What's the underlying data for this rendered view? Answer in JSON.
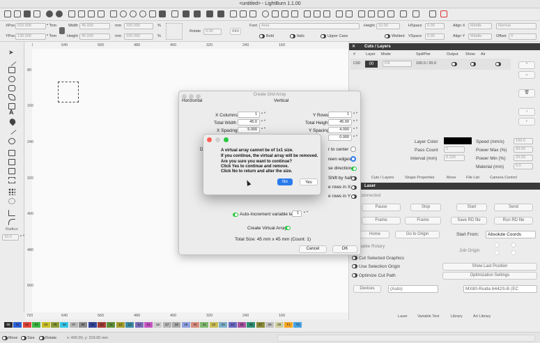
{
  "window": {
    "title": "<untitled> - LightBurn 1.1.00"
  },
  "position": {
    "xpos_label": "XPos",
    "xpos": "633.500",
    "ypos_label": "YPos",
    "ypos": "130.500",
    "unit": "mm",
    "width_label": "Width",
    "width": "45.000",
    "height_label": "Height",
    "height": "45.000",
    "scale_w": "100.000",
    "scale_h": "100.000",
    "pct": "%",
    "rotate_label": "Rotate",
    "rotate": "0.00",
    "mm_button": "mm"
  },
  "font": {
    "font_label": "Font",
    "font": "Arial",
    "height_label": "Height",
    "height": "10.00",
    "hspace_label": "HSpace",
    "hspace": "0.00",
    "align_x_label": "Align X",
    "align_x": "Middle",
    "normal": "Normal",
    "bold": "Bold",
    "italic": "Italic",
    "upper_case": "Upper Case",
    "welded": "Welded",
    "vspace_label": "VSpace",
    "vspace": "0.00",
    "align_y_label": "Align Y",
    "align_y": "Middle",
    "offset_label": "Offset",
    "offset": "0"
  },
  "left_tools": {
    "radius_label": "Radius:",
    "radius": "10.0"
  },
  "rulers": {
    "top": [
      "720",
      "640",
      "560",
      "480",
      "400",
      "320",
      "240",
      "160"
    ],
    "side": [
      "80",
      "160",
      "240",
      "320",
      "400",
      "480",
      "560"
    ],
    "bottom": [
      "720",
      "640",
      "560",
      "480",
      "400",
      "320",
      "240",
      "160"
    ]
  },
  "cuts_layers": {
    "title": "Cuts / Layers",
    "columns": [
      "#",
      "Layer",
      "Mode",
      "Spd/Pwr",
      "Output",
      "Show",
      "Air"
    ],
    "row": {
      "num": "C00",
      "layer": "00",
      "mode": "Fill",
      "spd_pwr": "100.0 / 20.0"
    },
    "layer_color_label": "Layer Color",
    "speed_label": "Speed (mm/s)",
    "speed": "100.0",
    "pass_count_label": "Pass Count",
    "pass_count": "1",
    "power_max_label": "Power Max (%)",
    "power_max": "20.00",
    "interval_label": "Interval (mm)",
    "interval": "0.100",
    "power_min_label": "Power Min (%)",
    "power_min": "20.00",
    "material_label": "Material (mm)",
    "material": "0.0"
  },
  "panel_tabs": [
    "Cuts / Layers",
    "Shape Properties",
    "Move",
    "File List",
    "Camera Control"
  ],
  "laser": {
    "title": "Laser",
    "status": "Disconnected",
    "pause": "Pause",
    "stop": "Stop",
    "start": "Start",
    "send": "Send",
    "frame1": "Frame",
    "frame2": "Frame",
    "save_rd": "Save RD file",
    "run_rd": "Run RD file",
    "home": "Home",
    "go_to_origin": "Go to Origin",
    "start_from_label": "Start From:",
    "start_from": "Absolute Coords",
    "enable_rotary": "Enable Rotary",
    "job_origin_label": "Job Origin",
    "cut_selected": "Cut Selected Graphics",
    "use_selection_origin": "Use Selection Origin",
    "show_last_position": "Show Last Position",
    "optimize_cut_path": "Optimize Cut Path",
    "optimization_settings": "Optimization Settings",
    "devices": "Devices",
    "port": "(Auto)",
    "device": "MX80-Ruida 6442S-B (EC"
  },
  "bottom_tabs": [
    "Laser",
    "Variable Text",
    "Library",
    "Art Library"
  ],
  "grid_dialog": {
    "title": "Create Grid Array",
    "horizontal": "Horizontal",
    "vertical": "Vertical",
    "x_columns_label": "X Columns",
    "x_columns": "1",
    "y_rows_label": "Y Rows",
    "y_rows": "1",
    "total_width_label": "Total Width",
    "total_width": "45.0",
    "total_height_label": "Total Height",
    "total_height": "45.00",
    "x_spacing_label": "X Spacing",
    "x_spacing": "5.000",
    "y_spacing_label": "Y Spacing",
    "y_spacing": "4.000",
    "extra_value": "0.000",
    "partial_d": "D",
    "partial_center": "r to center",
    "partial_edges": "reen edges",
    "partial_direction": "se direction",
    "partial_shift": "Shift by half",
    "partial_rows_x": "e rows in X",
    "partial_rows_y": "e rows in Y",
    "auto_increment": "Auto-Increment variable text",
    "auto_increment_val": "1",
    "create_virtual": "Create Virtual Array",
    "total_size": "Total Size: 45 mm x 45 mm  (Count: 1)",
    "cancel": "Cancel",
    "ok": "OK"
  },
  "message_box": {
    "lines": [
      "A virtual array cannot be of 1x1 size.",
      "If you continue, the virtual array will be removed.",
      "Are you sure you want to continue?",
      "Click Yes to continue and remove.",
      "Click No to return and alter the size."
    ],
    "no": "No",
    "yes": "Yes"
  },
  "palette": [
    "00",
    "01",
    "02",
    "03",
    "04",
    "05",
    "06",
    "07",
    "08",
    "09",
    "10",
    "11",
    "12",
    "13",
    "14",
    "15",
    "16",
    "17",
    "18",
    "19",
    "20",
    "21",
    "22",
    "23",
    "24",
    "25",
    "26",
    "27",
    "28",
    "29",
    "T1",
    "T2"
  ],
  "status": {
    "move": "Move",
    "size": "Size",
    "rotate": "Rotate",
    "coords": "x: 400.00, y: 319.00 mm"
  }
}
